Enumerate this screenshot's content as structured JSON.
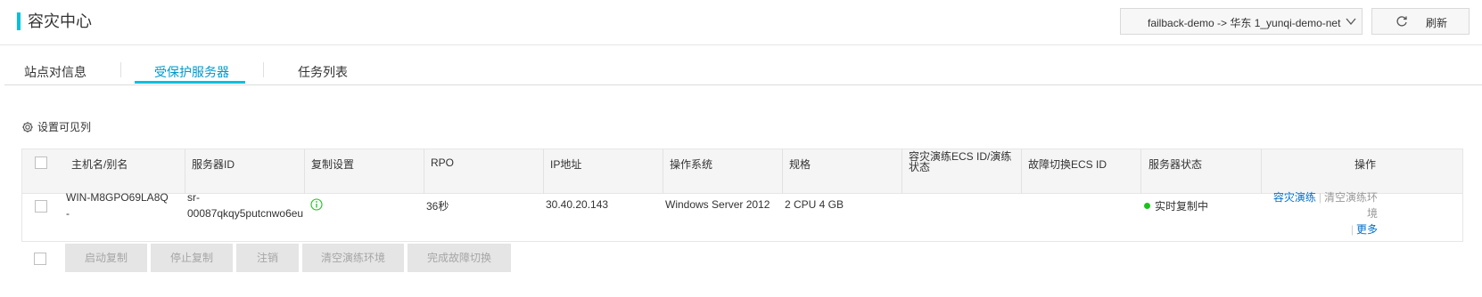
{
  "header": {
    "title": "容灾中心",
    "region_select_value": "failback-demo -> 华东 1_yunqi-demo-net",
    "refresh_label": "刷新",
    "accent_color": "#00c1de"
  },
  "tabs": [
    {
      "label": "站点对信息",
      "active": false
    },
    {
      "label": "受保护服务器",
      "active": true
    },
    {
      "label": "任务列表",
      "active": false
    }
  ],
  "toolbar": {
    "set_columns_label": "设置可见列"
  },
  "table": {
    "columns": [
      "主机名/别名",
      "服务器ID",
      "复制设置",
      "RPO",
      "IP地址",
      "操作系统",
      "规格",
      "容灾演练ECS ID/演练状态",
      "故障切换ECS ID",
      "服务器状态",
      "操作"
    ],
    "rows": [
      {
        "hostname": "WIN-M8GPO69LA8Q",
        "alias": "-",
        "server_id_line1": "sr-",
        "server_id_line2": "00087qkqy5putcnwo6eu",
        "rpo": "36秒",
        "ip": "30.40.20.143",
        "os": "Windows Server 2012",
        "spec": "2 CPU 4 GB",
        "drill_ecs": "",
        "failover_ecs": "",
        "status": "实时复制中",
        "status_color": "#1dc11d",
        "ops": {
          "drill": "容灾演练",
          "clear": "清空演练环境",
          "more": "更多"
        }
      }
    ]
  },
  "bulk_actions": [
    "启动复制",
    "停止复制",
    "注销",
    "清空演练环境",
    "完成故障切换"
  ]
}
